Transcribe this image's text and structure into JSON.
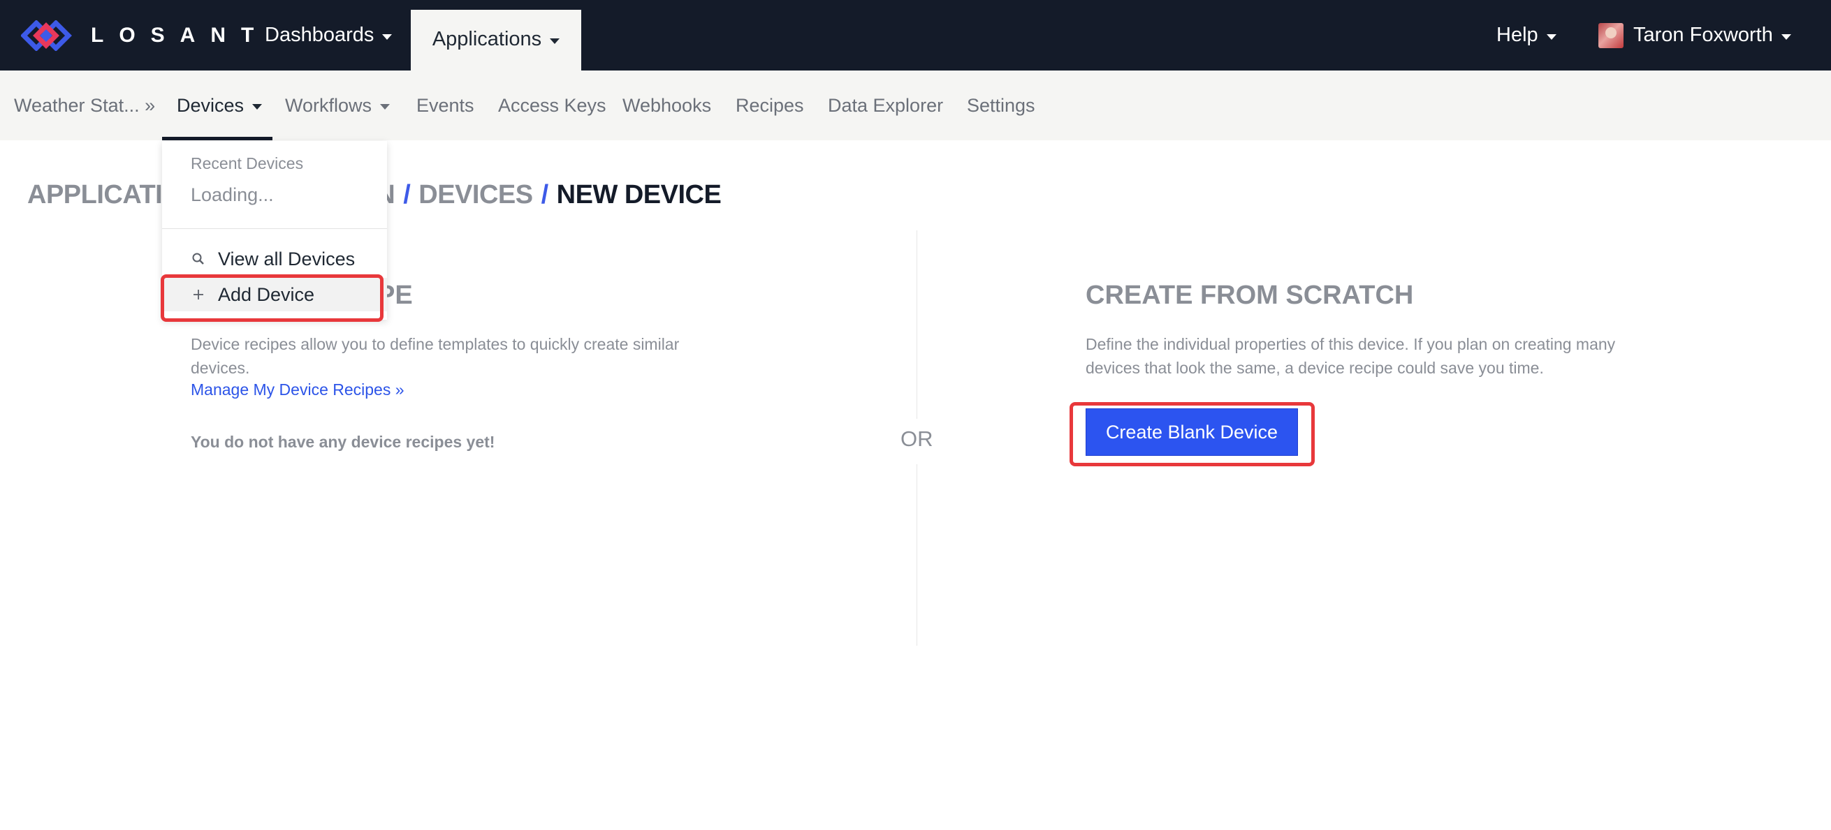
{
  "brand": {
    "name": "LOSANT",
    "logo_colors": [
      "#3d5ae8",
      "#e8385b"
    ]
  },
  "topnav": {
    "dashboards_label": "Dashboards",
    "applications_label": "Applications",
    "help_label": "Help",
    "user_name": "Taron Foxworth"
  },
  "subnav": {
    "app_name": "Weather Stat... »",
    "items": [
      {
        "label": "Devices"
      },
      {
        "label": "Workflows"
      },
      {
        "label": "Events"
      },
      {
        "label": "Access Keys"
      },
      {
        "label": "Webhooks"
      },
      {
        "label": "Recipes"
      },
      {
        "label": "Data Explorer"
      },
      {
        "label": "Settings"
      }
    ]
  },
  "dropdown": {
    "header": "Recent Devices",
    "loading": "Loading...",
    "view_all_label": "View all Devices",
    "add_device_label": "Add Device"
  },
  "breadcrumb": {
    "part1": "APPLICATION",
    "part2": "N",
    "part3": "DEVICES",
    "current": "NEW DEVICE",
    "separator": "/"
  },
  "left": {
    "heading_visible": "CIPE",
    "description": "Device recipes allow you to define templates to quickly create similar devices.",
    "manage_link": "Manage My Device Recipes »",
    "empty_note": "You do not have any device recipes yet!"
  },
  "divider": {
    "or_label": "OR"
  },
  "right": {
    "heading": "CREATE FROM SCRATCH",
    "description": "Define the individual properties of this device. If you plan on creating many devices that look the same, a device recipe could save you time.",
    "button_label": "Create Blank Device"
  },
  "colors": {
    "navbar_bg": "#141b29",
    "subnav_bg": "#f5f5f3",
    "primary": "#2c54f0",
    "link": "#2c54e8",
    "highlight": "#e8383b"
  },
  "icons": {
    "search": "search-icon",
    "plus": "plus-icon",
    "caret": "caret-down-icon"
  }
}
